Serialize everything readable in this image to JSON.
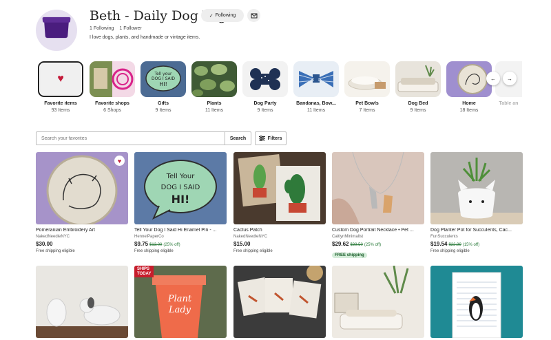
{
  "profile": {
    "name": "Beth - Daily Dog Tag",
    "following_label": "Following",
    "following_count": "1 Following",
    "follower_count": "1 Follower",
    "bio": "I love dogs, plants, and handmade or vintage items.",
    "icons": {
      "following": "check-icon",
      "message": "envelope-icon"
    }
  },
  "collections": [
    {
      "name": "Favorite items",
      "count": "93 Items"
    },
    {
      "name": "Favorite shops",
      "count": "6 Shops"
    },
    {
      "name": "Gifts",
      "count": "9 Items"
    },
    {
      "name": "Plants",
      "count": "11 Items"
    },
    {
      "name": "Dog Party",
      "count": "9 Items"
    },
    {
      "name": "Bandanas, Bow...",
      "count": "11 Items"
    },
    {
      "name": "Pet Bowls",
      "count": "7 Items"
    },
    {
      "name": "Dog Bed",
      "count": "9 Items"
    },
    {
      "name": "Home",
      "count": "18 Items"
    },
    {
      "name": "Table an",
      "count": ""
    }
  ],
  "scroll": {
    "prev": "previous-arrow-icon",
    "next": "next-arrow-icon"
  },
  "search": {
    "placeholder": "Search your favorites",
    "button": "Search",
    "filters": "Filters"
  },
  "items": [
    {
      "title": "Pomeranian Embroidery Art",
      "shop": "NakedNeedleNYC",
      "price": "$30.00",
      "original": "",
      "discount": "",
      "shipping": "Free shipping eligible"
    },
    {
      "title": "Tell Your Dog I Said Hi Enamel Pin - ...",
      "shop": "HennelPaperCo",
      "price": "$9.75",
      "original": "$13.00",
      "discount": "(25% off)",
      "shipping": "Free shipping eligible"
    },
    {
      "title": "Cactus Patch",
      "shop": "NakedNeedleNYC",
      "price": "$15.00",
      "original": "",
      "discount": "",
      "shipping": "Free shipping eligible"
    },
    {
      "title": "Custom Dog Portrait Necklace • Pet ...",
      "shop": "CaitlynMinimalist",
      "price": "$29.62",
      "original": "$39.50",
      "discount": "(25% off)",
      "shipping": "FREE shipping"
    },
    {
      "title": "Dog Planter Pot for Succulents, Cac...",
      "shop": "FunSucculents",
      "price": "$19.54",
      "original": "$22.99",
      "discount": "(15% off)",
      "shipping": "Free shipping eligible"
    }
  ],
  "image_text": {
    "pin": [
      "Tell Your",
      "DOG I SAID",
      "HI!"
    ],
    "ships_today": [
      "SHIPS",
      "TODAY"
    ],
    "plant_lady": [
      "Plant",
      "Lady"
    ],
    "gifts_thumb": [
      "Tell your",
      "DOG I SAID",
      "HI!"
    ]
  },
  "colors": {
    "heart": "#c41a3a",
    "sale": "#2a7a3a",
    "free_shipping_badge": "#d4ecd9",
    "avatar_bg": "#e6e0f0"
  }
}
